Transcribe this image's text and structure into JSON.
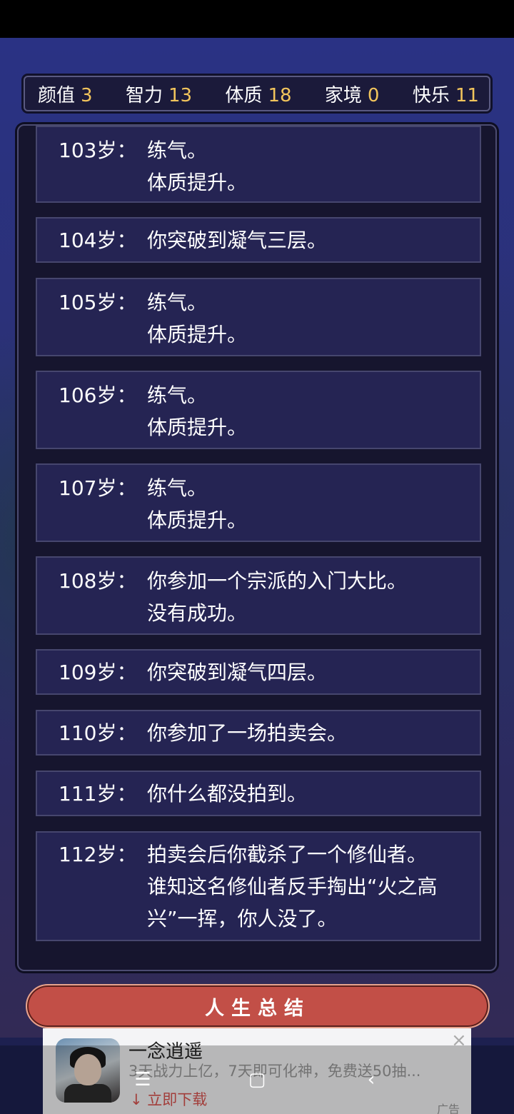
{
  "stats": [
    {
      "label": "颜值",
      "value": "3"
    },
    {
      "label": "智力",
      "value": "13"
    },
    {
      "label": "体质",
      "value": "18"
    },
    {
      "label": "家境",
      "value": "0"
    },
    {
      "label": "快乐",
      "value": "11"
    }
  ],
  "log": [
    {
      "age": "103岁：",
      "lines": [
        "练气。",
        "体质提升。"
      ]
    },
    {
      "age": "104岁：",
      "lines": [
        "你突破到凝气三层。"
      ]
    },
    {
      "age": "105岁：",
      "lines": [
        "练气。",
        "体质提升。"
      ]
    },
    {
      "age": "106岁：",
      "lines": [
        "练气。",
        "体质提升。"
      ]
    },
    {
      "age": "107岁：",
      "lines": [
        "练气。",
        "体质提升。"
      ]
    },
    {
      "age": "108岁：",
      "lines": [
        "你参加一个宗派的入门大比。",
        "没有成功。"
      ]
    },
    {
      "age": "109岁：",
      "lines": [
        "你突破到凝气四层。"
      ]
    },
    {
      "age": "110岁：",
      "lines": [
        "你参加了一场拍卖会。"
      ]
    },
    {
      "age": "111岁：",
      "lines": [
        "你什么都没拍到。"
      ]
    },
    {
      "age": "112岁：",
      "lines": [
        "拍卖会后你截杀了一个修仙者。",
        "谁知这名修仙者反手掏出“火之高",
        "兴”一挥，你人没了。"
      ]
    }
  ],
  "summary_button": "人生总结",
  "ad": {
    "title": "一念逍遥",
    "description": "3天战力上亿，7天即可化神，免费送50抽...",
    "download": "立即下载",
    "close": "×",
    "mark": "广告"
  },
  "nav": {
    "menu": "☰",
    "home": "▢",
    "back": "‹"
  }
}
